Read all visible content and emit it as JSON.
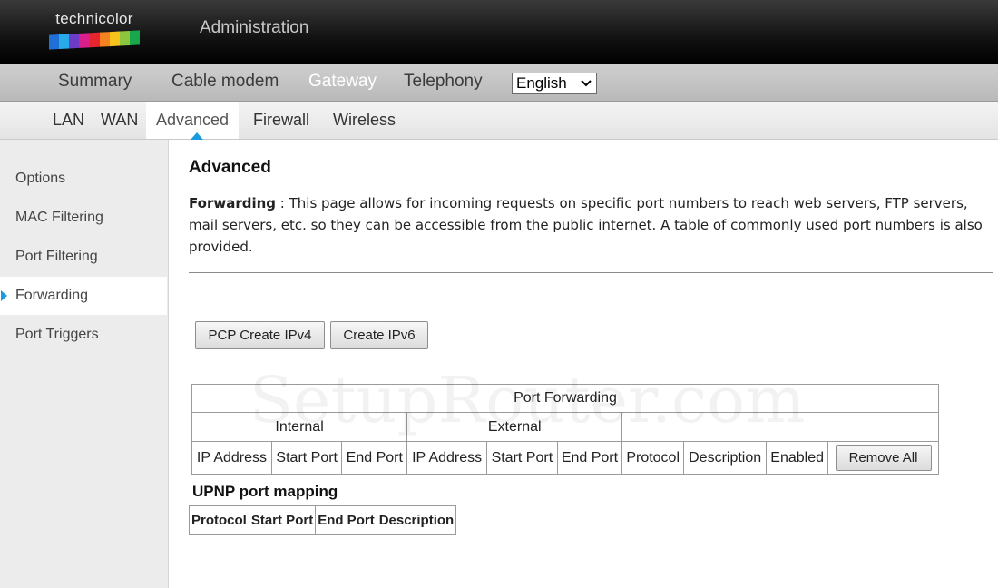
{
  "header": {
    "logo_text": "technicolor",
    "logo_colors": [
      "#1f6fd6",
      "#28a9e8",
      "#6c3cc6",
      "#d91f8c",
      "#e8242f",
      "#f58220",
      "#f6c21b",
      "#8cc63e",
      "#1aa64a"
    ],
    "title": "Administration"
  },
  "main_nav": {
    "items": [
      {
        "label": "Summary"
      },
      {
        "label": "Cable modem"
      },
      {
        "label": "Gateway"
      },
      {
        "label": "Telephony"
      }
    ],
    "active": "Gateway",
    "language": {
      "selected": "English"
    }
  },
  "sub_nav": {
    "items": [
      {
        "label": "LAN"
      },
      {
        "label": "WAN"
      },
      {
        "label": "Advanced"
      },
      {
        "label": "Firewall"
      },
      {
        "label": "Wireless"
      }
    ],
    "active": "Advanced",
    "accent": "#1a9be0"
  },
  "sidebar": {
    "items": [
      {
        "label": "Options"
      },
      {
        "label": "MAC Filtering"
      },
      {
        "label": "Port Filtering"
      },
      {
        "label": "Forwarding"
      },
      {
        "label": "Port Triggers"
      }
    ],
    "active": "Forwarding"
  },
  "content": {
    "title": "Advanced",
    "desc_label": "Forwarding",
    "desc_sep": " : ",
    "desc_text": "This page allows for incoming requests on specific port numbers to reach web servers, FTP servers, mail servers, etc. so they can be accessible from the public internet. A table of commonly used port numbers is also provided.",
    "buttons": {
      "pcp_create_ipv4": "PCP Create IPv4",
      "create_ipv6": "Create IPv6"
    },
    "port_forwarding": {
      "title": "Port Forwarding",
      "group_internal": "Internal",
      "group_external": "External",
      "columns": [
        "IP Address",
        "Start Port",
        "End Port",
        "IP Address",
        "Start Port",
        "End Port",
        "Protocol",
        "Description",
        "Enabled"
      ],
      "remove_all": "Remove All"
    },
    "upnp": {
      "title": "UPNP port mapping",
      "columns": [
        "Protocol",
        "Start Port",
        "End Port",
        "Description"
      ]
    }
  },
  "watermark": "SetupRouter.com"
}
